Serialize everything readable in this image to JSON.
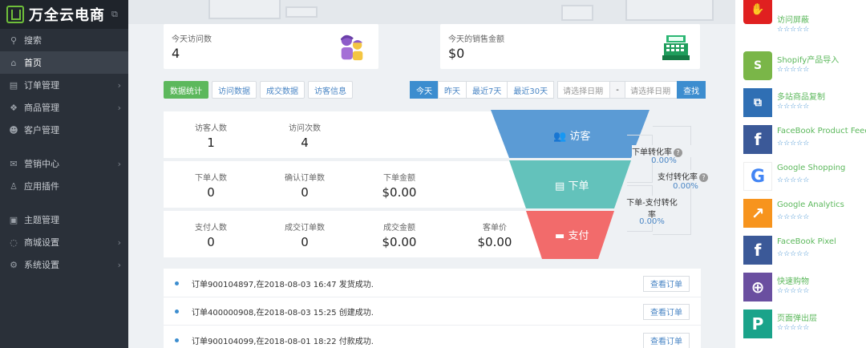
{
  "sidebar": {
    "logo": "万全云电商",
    "items": [
      {
        "label": "搜索",
        "icon": "search-icon",
        "glyph": "⚲"
      },
      {
        "label": "首页",
        "icon": "home-icon",
        "glyph": "⌂"
      },
      {
        "label": "订单管理",
        "icon": "order-icon",
        "glyph": "▤"
      },
      {
        "label": "商品管理",
        "icon": "product-icon",
        "glyph": "❖"
      },
      {
        "label": "客户管理",
        "icon": "customer-icon",
        "glyph": "☻"
      },
      {
        "label": "营销中心",
        "icon": "marketing-icon",
        "glyph": "✉"
      },
      {
        "label": "应用插件",
        "icon": "plugin-icon",
        "glyph": "♙"
      },
      {
        "label": "主题管理",
        "icon": "theme-icon",
        "glyph": "▣"
      },
      {
        "label": "商城设置",
        "icon": "store-settings-icon",
        "glyph": "◌"
      },
      {
        "label": "系统设置",
        "icon": "system-settings-icon",
        "glyph": "⚙"
      }
    ]
  },
  "stats": {
    "visits_label": "今天访问数",
    "visits_value": "4",
    "sales_label": "今天的销售金额",
    "sales_value": "$0"
  },
  "tabs": {
    "left": [
      "数据统计",
      "访问数据",
      "成交数据",
      "访客信息"
    ],
    "right": [
      "今天",
      "昨天",
      "最近7天",
      "最近30天"
    ],
    "date_placeholder": "请选择日期",
    "date_sep": "-",
    "search": "查找"
  },
  "rows": {
    "row1": [
      {
        "label": "访客人数",
        "value": "1"
      },
      {
        "label": "访问次数",
        "value": "4"
      }
    ],
    "row2": [
      {
        "label": "下单人数",
        "value": "0"
      },
      {
        "label": "确认订单数",
        "value": "0"
      },
      {
        "label": "下单金额",
        "value": "$0.00"
      }
    ],
    "row3": [
      {
        "label": "支付人数",
        "value": "0"
      },
      {
        "label": "成交订单数",
        "value": "0"
      },
      {
        "label": "成交金额",
        "value": "$0.00"
      },
      {
        "label": "客单价",
        "value": "$0.00"
      }
    ]
  },
  "funnel": {
    "stage1": "访客",
    "stage2": "下单",
    "stage3": "支付",
    "colors": [
      "#5b9bd5",
      "#63c2bb",
      "#f26b6b"
    ]
  },
  "rates": {
    "order_rate_label": "下单转化率",
    "order_rate_value": "0.00%",
    "pay_rate_label": "支付转化率",
    "pay_rate_value": "0.00%",
    "order_pay_rate_label": "下单-支付转化率",
    "order_pay_rate_value": "0.00%"
  },
  "orders": [
    {
      "text": "订单900104897,在2018-08-03 16:47 发货成功.",
      "action": "查看订单"
    },
    {
      "text": "订单400000908,在2018-08-03 15:25 创建成功.",
      "action": "查看订单"
    },
    {
      "text": "订单900104099,在2018-08-01 18:22 付款成功.",
      "action": "查看订单"
    }
  ],
  "apps": [
    {
      "name": "访问屏蔽",
      "icon": "block-hand-icon",
      "color": "#e02020",
      "glyph": "✋",
      "stars": "☆☆☆☆☆"
    },
    {
      "name": "Shopify产品导入",
      "icon": "shopify-icon",
      "color": "#7ab648",
      "glyph": "S",
      "stars": "☆☆☆☆☆"
    },
    {
      "name": "多站商品复制",
      "icon": "copy-icon",
      "color": "#2f6fb4",
      "glyph": "⧉",
      "stars": "☆☆☆☆☆"
    },
    {
      "name": "FaceBook Product Feed",
      "icon": "facebook-feed-icon",
      "color": "#3b5998",
      "glyph": "f",
      "stars": "☆☆☆☆☆"
    },
    {
      "name": "Google Shopping",
      "icon": "google-icon",
      "color": "#ffffff",
      "glyph": "G",
      "stars": "☆☆☆☆☆"
    },
    {
      "name": "Google Analytics",
      "icon": "analytics-icon",
      "color": "#f7941d",
      "glyph": "↗",
      "stars": "☆☆☆☆☆"
    },
    {
      "name": "FaceBook Pixel",
      "icon": "facebook-pixel-icon",
      "color": "#3b5998",
      "glyph": "f",
      "stars": "☆☆☆☆☆"
    },
    {
      "name": "快速购物",
      "icon": "quick-cart-icon",
      "color": "#6a4fa0",
      "glyph": "⊕",
      "stars": "☆☆☆☆☆"
    },
    {
      "name": "页面弹出层",
      "icon": "popup-icon",
      "color": "#1aa38a",
      "glyph": "P",
      "stars": "☆☆☆☆☆"
    }
  ]
}
